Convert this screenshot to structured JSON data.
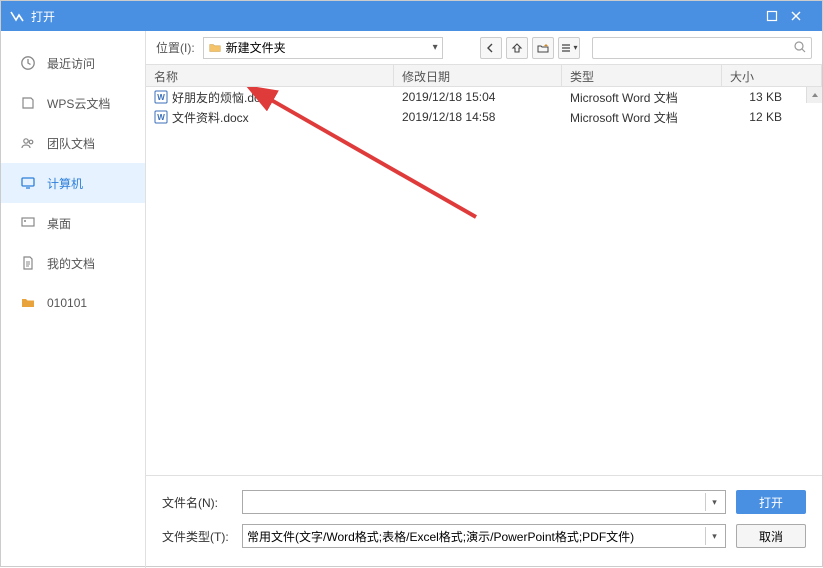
{
  "window": {
    "title": "打开"
  },
  "sidebar": {
    "items": [
      {
        "label": "最近访问"
      },
      {
        "label": "WPS云文档"
      },
      {
        "label": "团队文档"
      },
      {
        "label": "计算机"
      },
      {
        "label": "桌面"
      },
      {
        "label": "我的文档"
      },
      {
        "label": "010101"
      }
    ],
    "active_index": 3
  },
  "toolbar": {
    "location_label": "位置(I):",
    "current_path": "新建文件夹"
  },
  "columns": {
    "name": "名称",
    "date": "修改日期",
    "type": "类型",
    "size": "大小"
  },
  "files": [
    {
      "name": "好朋友的烦恼.docx",
      "date": "2019/12/18 15:04",
      "type": "Microsoft Word 文档",
      "size": "13 KB"
    },
    {
      "name": "文件资料.docx",
      "date": "2019/12/18 14:58",
      "type": "Microsoft Word 文档",
      "size": "12 KB"
    }
  ],
  "footer": {
    "filename_label": "文件名(N):",
    "filetype_label": "文件类型(T):",
    "filename_value": "",
    "filetype_value": "常用文件(文字/Word格式;表格/Excel格式;演示/PowerPoint格式;PDF文件)",
    "open_label": "打开",
    "cancel_label": "取消"
  }
}
